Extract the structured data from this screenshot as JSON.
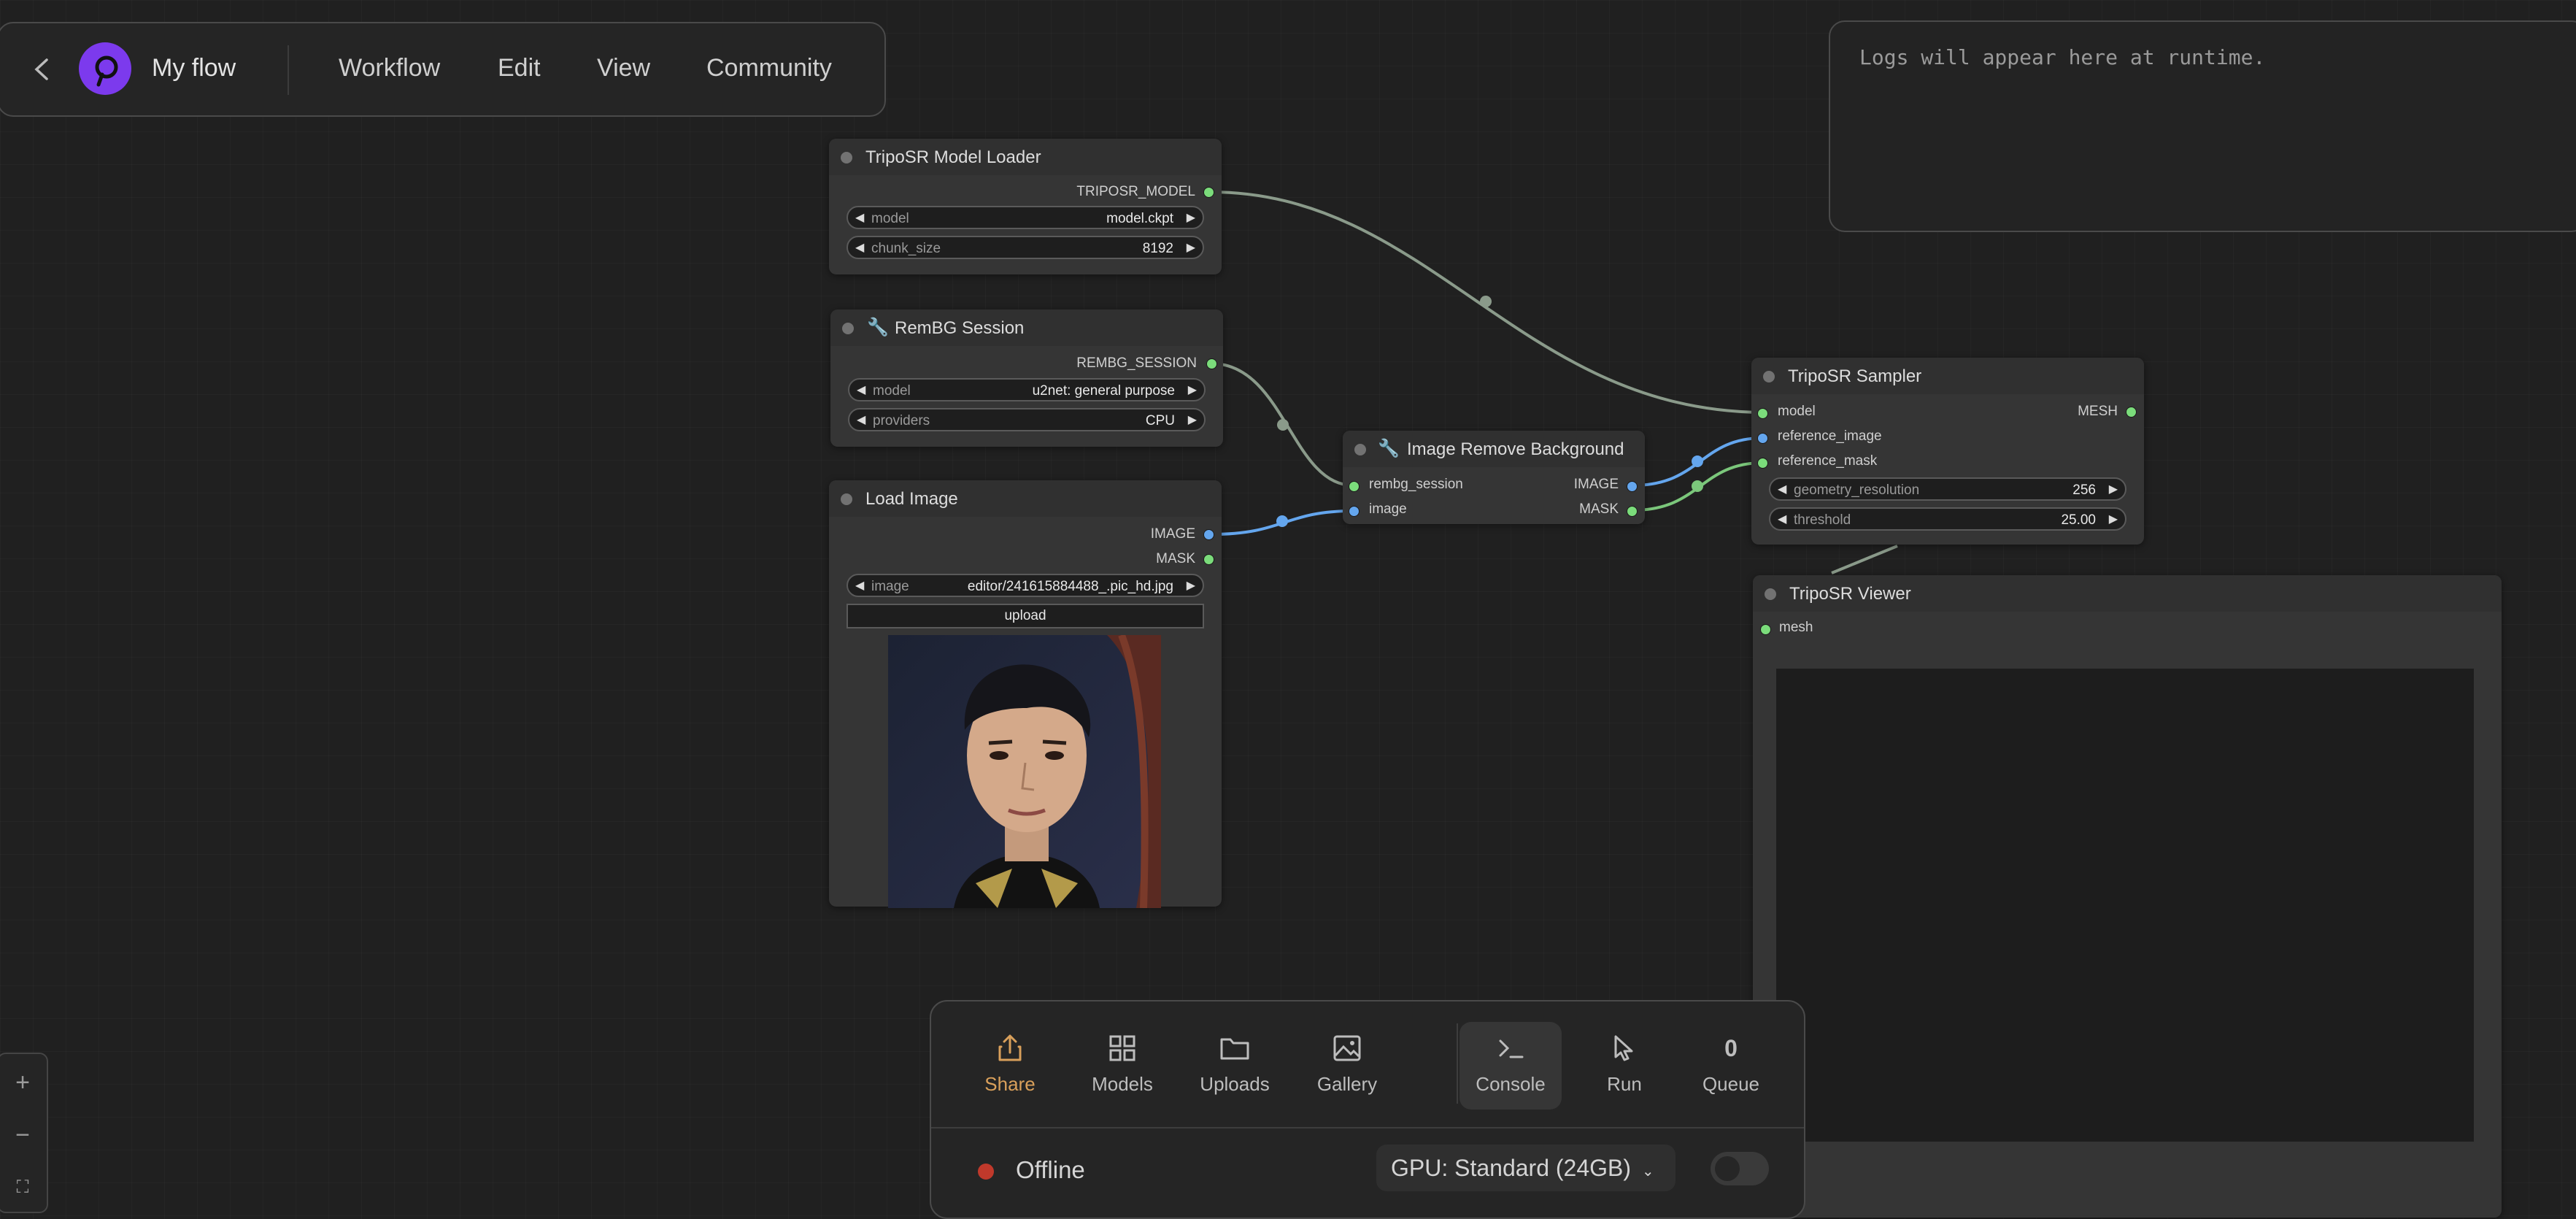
{
  "topbar": {
    "title": "My flow",
    "menus": [
      "Workflow",
      "Edit",
      "View",
      "Community"
    ]
  },
  "logs": {
    "placeholder": "Logs will appear here at runtime."
  },
  "nodes": {
    "model_loader": {
      "title": "TripoSR Model Loader",
      "output": "TRIPOSR_MODEL",
      "widgets": [
        {
          "name": "model",
          "value": "model.ckpt"
        },
        {
          "name": "chunk_size",
          "value": "8192"
        }
      ]
    },
    "rembg_session": {
      "title": "RemBG Session",
      "output": "REMBG_SESSION",
      "widgets": [
        {
          "name": "model",
          "value": "u2net: general purpose"
        },
        {
          "name": "providers",
          "value": "CPU"
        }
      ]
    },
    "load_image": {
      "title": "Load Image",
      "outputs": [
        "IMAGE",
        "MASK"
      ],
      "widget": {
        "name": "image",
        "value": "editor/241615884488_.pic_hd.jpg"
      },
      "upload_label": "upload"
    },
    "remove_bg": {
      "title": "Image Remove Background",
      "inputs": [
        "rembg_session",
        "image"
      ],
      "outputs": [
        "IMAGE",
        "MASK"
      ]
    },
    "sampler": {
      "title": "TripoSR Sampler",
      "inputs": [
        "model",
        "reference_image",
        "reference_mask"
      ],
      "output": "MESH",
      "widgets": [
        {
          "name": "geometry_resolution",
          "value": "256"
        },
        {
          "name": "threshold",
          "value": "25.00"
        }
      ]
    },
    "viewer": {
      "title": "TripoSR Viewer",
      "input": "mesh"
    }
  },
  "dock": {
    "buttons": [
      {
        "label": "Share",
        "icon": "share-icon"
      },
      {
        "label": "Models",
        "icon": "grid-icon"
      },
      {
        "label": "Uploads",
        "icon": "folder-icon"
      },
      {
        "label": "Gallery",
        "icon": "image-icon"
      },
      {
        "label": "Console",
        "icon": "terminal-icon"
      },
      {
        "label": "Run",
        "icon": "cursor-icon"
      },
      {
        "label": "Queue",
        "count": "0"
      }
    ],
    "status": "Offline",
    "gpu": "GPU: Standard (24GB)",
    "colors": {
      "accent": "#d9a05b",
      "offline": "#c0392b"
    }
  }
}
